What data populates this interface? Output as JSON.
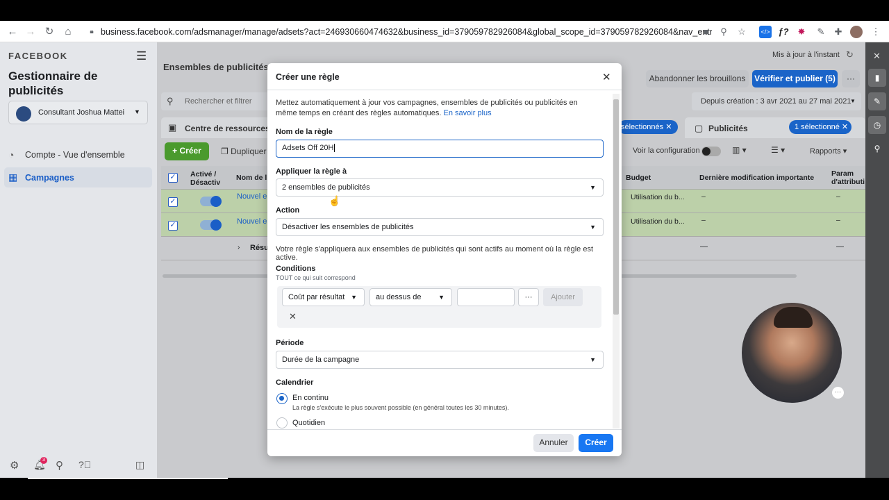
{
  "browser": {
    "url": "business.facebook.com/adsmanager/manage/adsets?act=246930660474632&business_id=379059782926084&global_scope_id=379059782926084&nav_entry_poin..."
  },
  "sidebar": {
    "brand": "FACEBOOK",
    "title": "Gestionnaire de publicités",
    "account": "Consultant Joshua Mattei",
    "items": [
      {
        "label": "Compte - Vue d'ensemble"
      },
      {
        "label": "Campagnes"
      }
    ],
    "notif_count": "3"
  },
  "header": {
    "title": "Ensembles de publicités",
    "updated": "Mis à jour à l'instant",
    "discard": "Abandonner les brouillons",
    "publish": "Vérifier et publier (5)",
    "search_placeholder": "Rechercher et filtrer",
    "date_range": "Depuis création : 3 avr 2021 au 27 mai 2021",
    "resources": "Centre de ressources",
    "selected_left": "sélectionnés",
    "ads_tab": "Publicités",
    "selected_right": "1 sélectionné",
    "create": "Créer",
    "duplicate": "Dupliquer",
    "view_config": "Voir la configuration",
    "reports": "Rapports"
  },
  "table": {
    "headers": [
      "Activé / Désactiv",
      "Nom de l'",
      "Budget",
      "Dernière modification importante",
      "Param d'attributi"
    ],
    "rows": [
      {
        "name": "Nouvel en",
        "budget": "Utilisation du b...",
        "last": "–",
        "param": "–"
      },
      {
        "name": "Nouvel en",
        "budget": "Utilisation du b...",
        "last": "–",
        "param": "–"
      }
    ],
    "summary": "Résu",
    "summary_dash": "—"
  },
  "modal": {
    "title": "Créer une règle",
    "intro": "Mettez automatiquement à jour vos campagnes, ensembles de publicités ou publicités en même temps en créant des règles automatiques.",
    "learn_more": "En savoir plus",
    "name_label": "Nom de la règle",
    "name_value": "Adsets Off 20H",
    "apply_label": "Appliquer la règle à",
    "apply_value": "2 ensembles de publicités",
    "action_label": "Action",
    "action_value": "Désactiver les ensembles de publicités",
    "action_note": "Votre règle s'appliquera aux ensembles de publicités qui sont actifs au moment où la règle est active.",
    "conditions_label": "Conditions",
    "conditions_sub": "TOUT ce qui suit correspond",
    "cond_metric": "Coût par résultat",
    "cond_op": "au dessus de",
    "cond_more": "···",
    "cond_add": "Ajouter",
    "period_label": "Période",
    "period_value": "Durée de la campagne",
    "schedule_label": "Calendrier",
    "schedule_continuous": "En continu",
    "schedule_continuous_sub": "La règle s'exécute le plus souvent possible (en général toutes les 30 minutes).",
    "schedule_daily": "Quotidien",
    "cancel": "Annuler",
    "create": "Créer"
  }
}
